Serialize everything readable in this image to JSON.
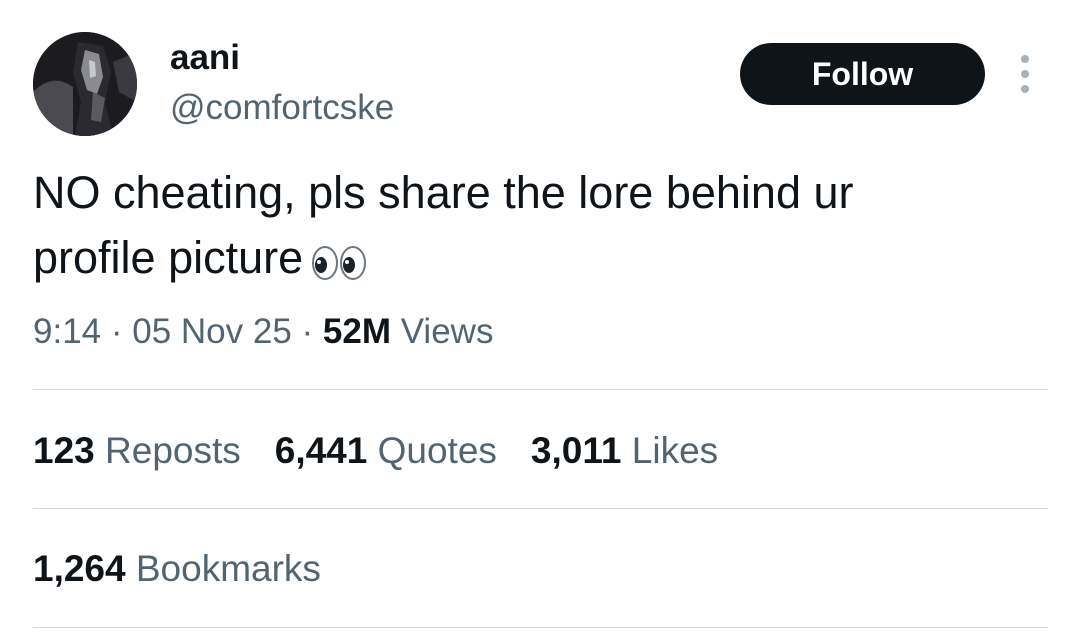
{
  "author": {
    "display_name": "aani",
    "handle": "@comfortcske"
  },
  "follow_button": {
    "label": "Follow"
  },
  "tweet": {
    "text": "NO cheating, pls share the lore behind ur\nprofile picture"
  },
  "meta": {
    "time": "9:14",
    "separator_1": " · ",
    "date": "05 Nov 25",
    "separator_2": " · ",
    "views_count": "52M",
    "views_label": " Views"
  },
  "stats": {
    "reposts": {
      "count": "123",
      "label": "Reposts"
    },
    "quotes": {
      "count": "6,441",
      "label": "Quotes"
    },
    "likes": {
      "count": "3,011",
      "label": "Likes"
    },
    "bookmarks": {
      "count": "1,264",
      "label": "Bookmarks"
    }
  },
  "icons": {
    "more": "more-vertical-icon",
    "emoji": "eyes-emoji-icon"
  },
  "colors": {
    "primary_text": "#0f1419",
    "secondary_text": "#536471",
    "follow_bg": "#0f1419",
    "divider": "#cfd9de"
  }
}
